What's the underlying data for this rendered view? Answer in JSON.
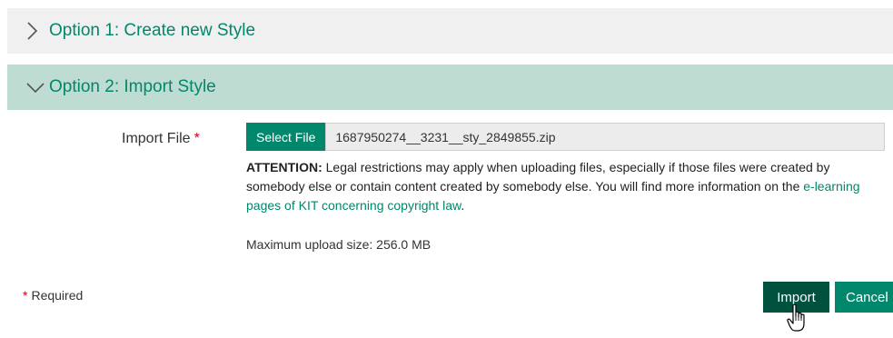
{
  "accordion": {
    "option1": {
      "title": "Option 1: Create new Style",
      "state": "collapsed"
    },
    "option2": {
      "title": "Option 2: Import Style",
      "state": "expanded"
    }
  },
  "import_form": {
    "file_label": "Import File",
    "required_mark": "*",
    "select_button": "Select File",
    "file_value": "1687950274__3231__sty_2849855.zip",
    "attention_label": "ATTENTION:",
    "attention_text": "Legal restrictions may apply when uploading files, especially if those files were created by somebody else or contain content created by somebody else. You will find more information on the",
    "attention_link": "e-learning pages of KIT concerning copyright law",
    "attention_end": ".",
    "max_upload": "Maximum upload size: 256.0 MB"
  },
  "footer": {
    "required_mark": "*",
    "required_label": "Required",
    "import_button": "Import",
    "cancel_button": "Cancel"
  },
  "colors": {
    "accent": "#00876c",
    "accent_dark": "#00523f",
    "expanded_header_bg": "#bfdcd2",
    "collapsed_header_bg": "#f0f0f0",
    "required": "#d0001a"
  },
  "icons": {
    "option1": "chevron-right-icon",
    "option2": "chevron-down-icon",
    "cursor": "hand-pointer-cursor"
  }
}
